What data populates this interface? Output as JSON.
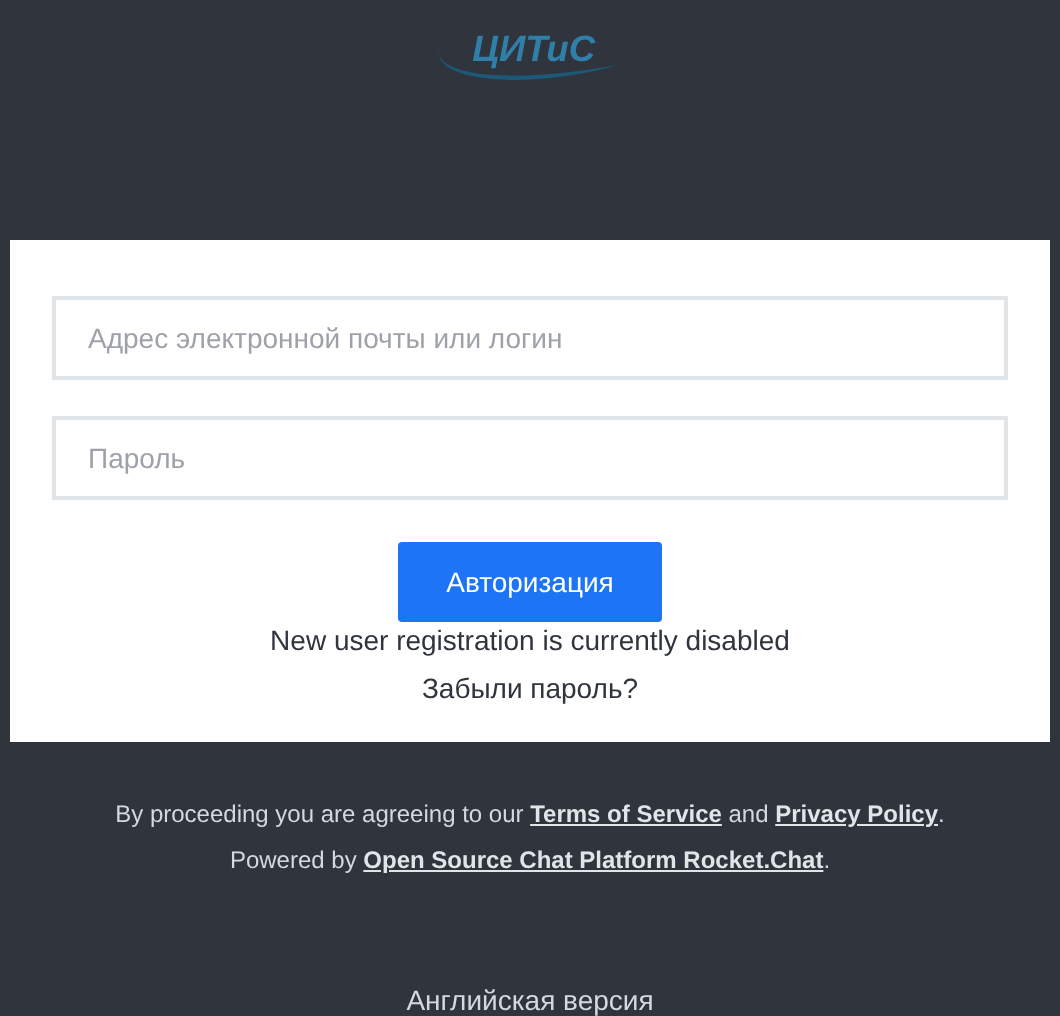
{
  "logo": {
    "text": "ЦИТиС"
  },
  "login_form": {
    "email": {
      "placeholder": "Адрес электронной почты или логин"
    },
    "password": {
      "placeholder": "Пароль"
    },
    "submit": "Авторизация",
    "registration_note": "New user registration is currently disabled",
    "forgot_password": "Забыли пароль?"
  },
  "legal": {
    "prefix": "By proceeding you are agreeing to our ",
    "terms": "Terms of Service",
    "middle": " and ",
    "privacy": "Privacy Policy",
    "suffix": "."
  },
  "powered": {
    "prefix": "Powered by ",
    "link": "Open Source Chat Platform Rocket.Chat",
    "suffix": "."
  },
  "language_link": "Английская версия"
}
